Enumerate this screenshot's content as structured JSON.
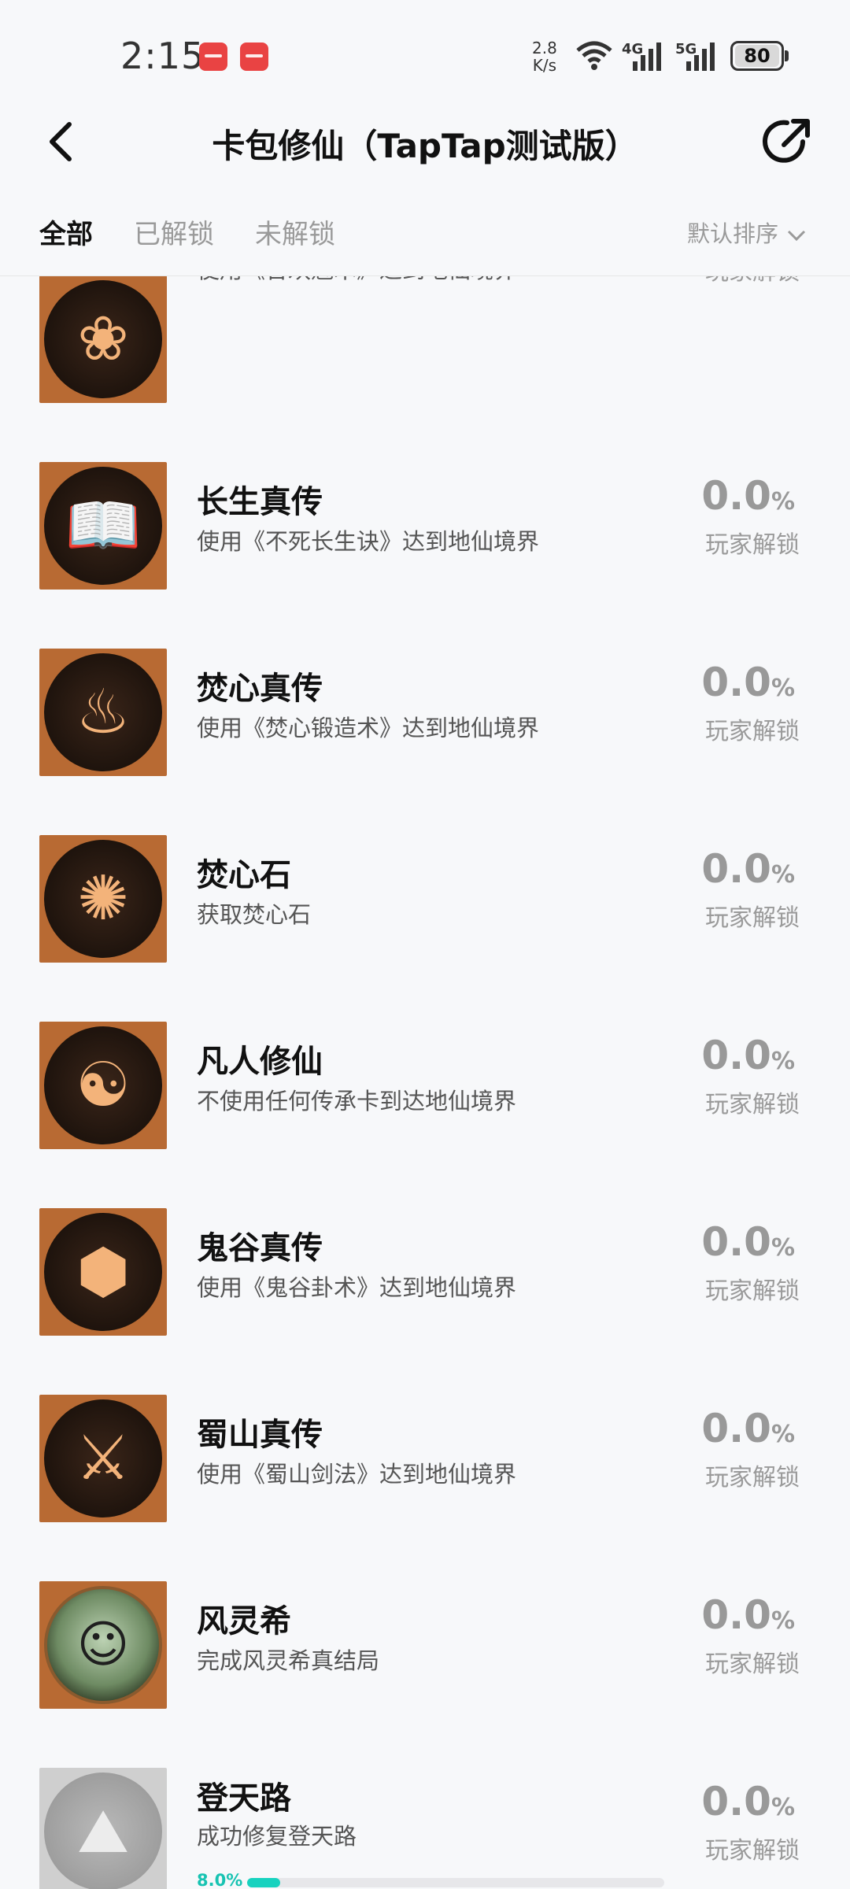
{
  "status_bar": {
    "time": "2:15",
    "net_speed_value": "2.8",
    "net_speed_unit": "K/s",
    "signal_1_label": "4G",
    "signal_2_label": "5G",
    "battery": "80"
  },
  "header": {
    "title": "卡包修仙（TapTap测试版）"
  },
  "tabs": [
    {
      "label": "全部",
      "active": true
    },
    {
      "label": "已解锁",
      "active": false
    },
    {
      "label": "未解锁",
      "active": false
    }
  ],
  "sort": {
    "label": "默认排序"
  },
  "achievements": [
    {
      "name": "",
      "desc": "使用《合欢魅术》达到地仙境界",
      "percent": "",
      "unlock_label": "玩家解锁",
      "icon": "lotus-icon"
    },
    {
      "name": "长生真传",
      "desc": "使用《不死长生诀》达到地仙境界",
      "percent": "0.0",
      "percent_sign": "%",
      "unlock_label": "玩家解锁",
      "icon": "book-icon"
    },
    {
      "name": "焚心真传",
      "desc": "使用《焚心锻造术》达到地仙境界",
      "percent": "0.0",
      "percent_sign": "%",
      "unlock_label": "玩家解锁",
      "icon": "flame-forge-icon"
    },
    {
      "name": "焚心石",
      "desc": "获取焚心石",
      "percent": "0.0",
      "percent_sign": "%",
      "unlock_label": "玩家解锁",
      "icon": "flame-stone-icon"
    },
    {
      "name": "凡人修仙",
      "desc": "不使用任何传承卡到达地仙境界",
      "percent": "0.0",
      "percent_sign": "%",
      "unlock_label": "玩家解锁",
      "icon": "mortal-icon"
    },
    {
      "name": "鬼谷真传",
      "desc": "使用《鬼谷卦术》达到地仙境界",
      "percent": "0.0",
      "percent_sign": "%",
      "unlock_label": "玩家解锁",
      "icon": "turtle-icon"
    },
    {
      "name": "蜀山真传",
      "desc": "使用《蜀山剑法》达到地仙境界",
      "percent": "0.0",
      "percent_sign": "%",
      "unlock_label": "玩家解锁",
      "icon": "sword-icon"
    },
    {
      "name": "风灵希",
      "desc": "完成风灵希真结局",
      "percent": "0.0",
      "percent_sign": "%",
      "unlock_label": "玩家解锁",
      "icon": "portrait-icon"
    },
    {
      "name": "登天路",
      "desc": "成功修复登天路",
      "percent": "0.0",
      "percent_sign": "%",
      "unlock_label": "玩家解锁",
      "icon": "mountain-icon",
      "progress_label": "8.0%",
      "progress": 0.08
    }
  ]
}
